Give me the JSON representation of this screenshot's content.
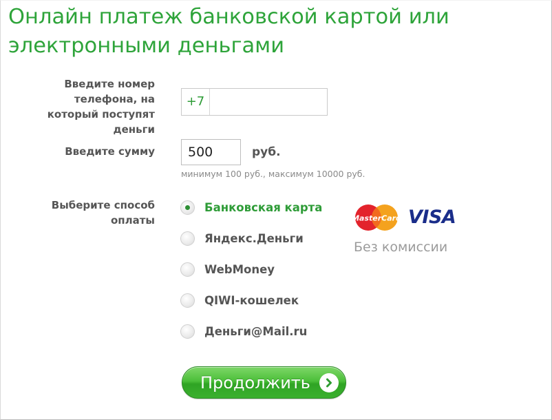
{
  "title": "Онлайн платеж банковской картой или электронными деньгами",
  "phone": {
    "label": "Введите номер телефона, на который поступят деньги",
    "prefix": "+7",
    "value": ""
  },
  "sum": {
    "label": "Введите сумму",
    "value": "500",
    "currency": "руб.",
    "hint": "минимум 100 руб., максимум 10000 руб."
  },
  "method": {
    "label": "Выберите способ оплаты",
    "options": [
      {
        "label": "Банковская карта",
        "selected": true
      },
      {
        "label": "Яндекс.Деньги",
        "selected": false
      },
      {
        "label": "WebMoney",
        "selected": false
      },
      {
        "label": "QIWI-кошелек",
        "selected": false
      },
      {
        "label": "Деньги@Mail.ru",
        "selected": false
      }
    ],
    "card_logos": {
      "mastercard": "MasterCard",
      "visa": "VISA"
    },
    "no_commission": "Без комиссии"
  },
  "submit": {
    "label": "Продолжить",
    "icon": "arrow-right-circle-icon"
  },
  "colors": {
    "accent": "#2ea43a",
    "button": "#3bb02f",
    "label": "#555555",
    "hint": "#8a8a8a",
    "visa": "#1a2d8a"
  }
}
